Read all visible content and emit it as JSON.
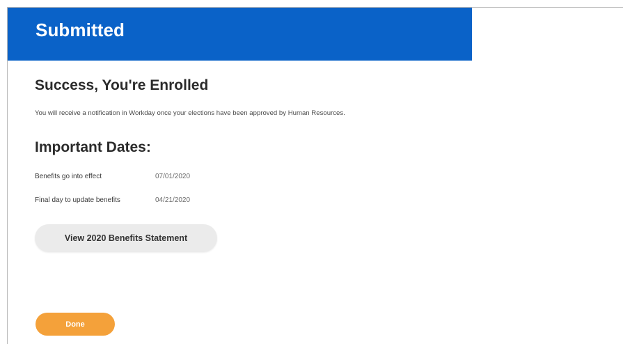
{
  "header": {
    "title": "Submitted"
  },
  "main": {
    "success_title": "Success, You're Enrolled",
    "notice": "You will receive a notification in Workday once your elections have been approved by Human Resources.",
    "dates_title": "Important Dates:",
    "dates": [
      {
        "label": "Benefits go into effect",
        "value": "07/01/2020"
      },
      {
        "label": "Final day to update benefits",
        "value": "04/21/2020"
      }
    ],
    "statement_button_label": "View 2020 Benefits Statement",
    "done_button_label": "Done"
  },
  "colors": {
    "header_bg": "#0a62c8",
    "done_button": "#f4a13a",
    "secondary_button": "#ebebeb"
  }
}
